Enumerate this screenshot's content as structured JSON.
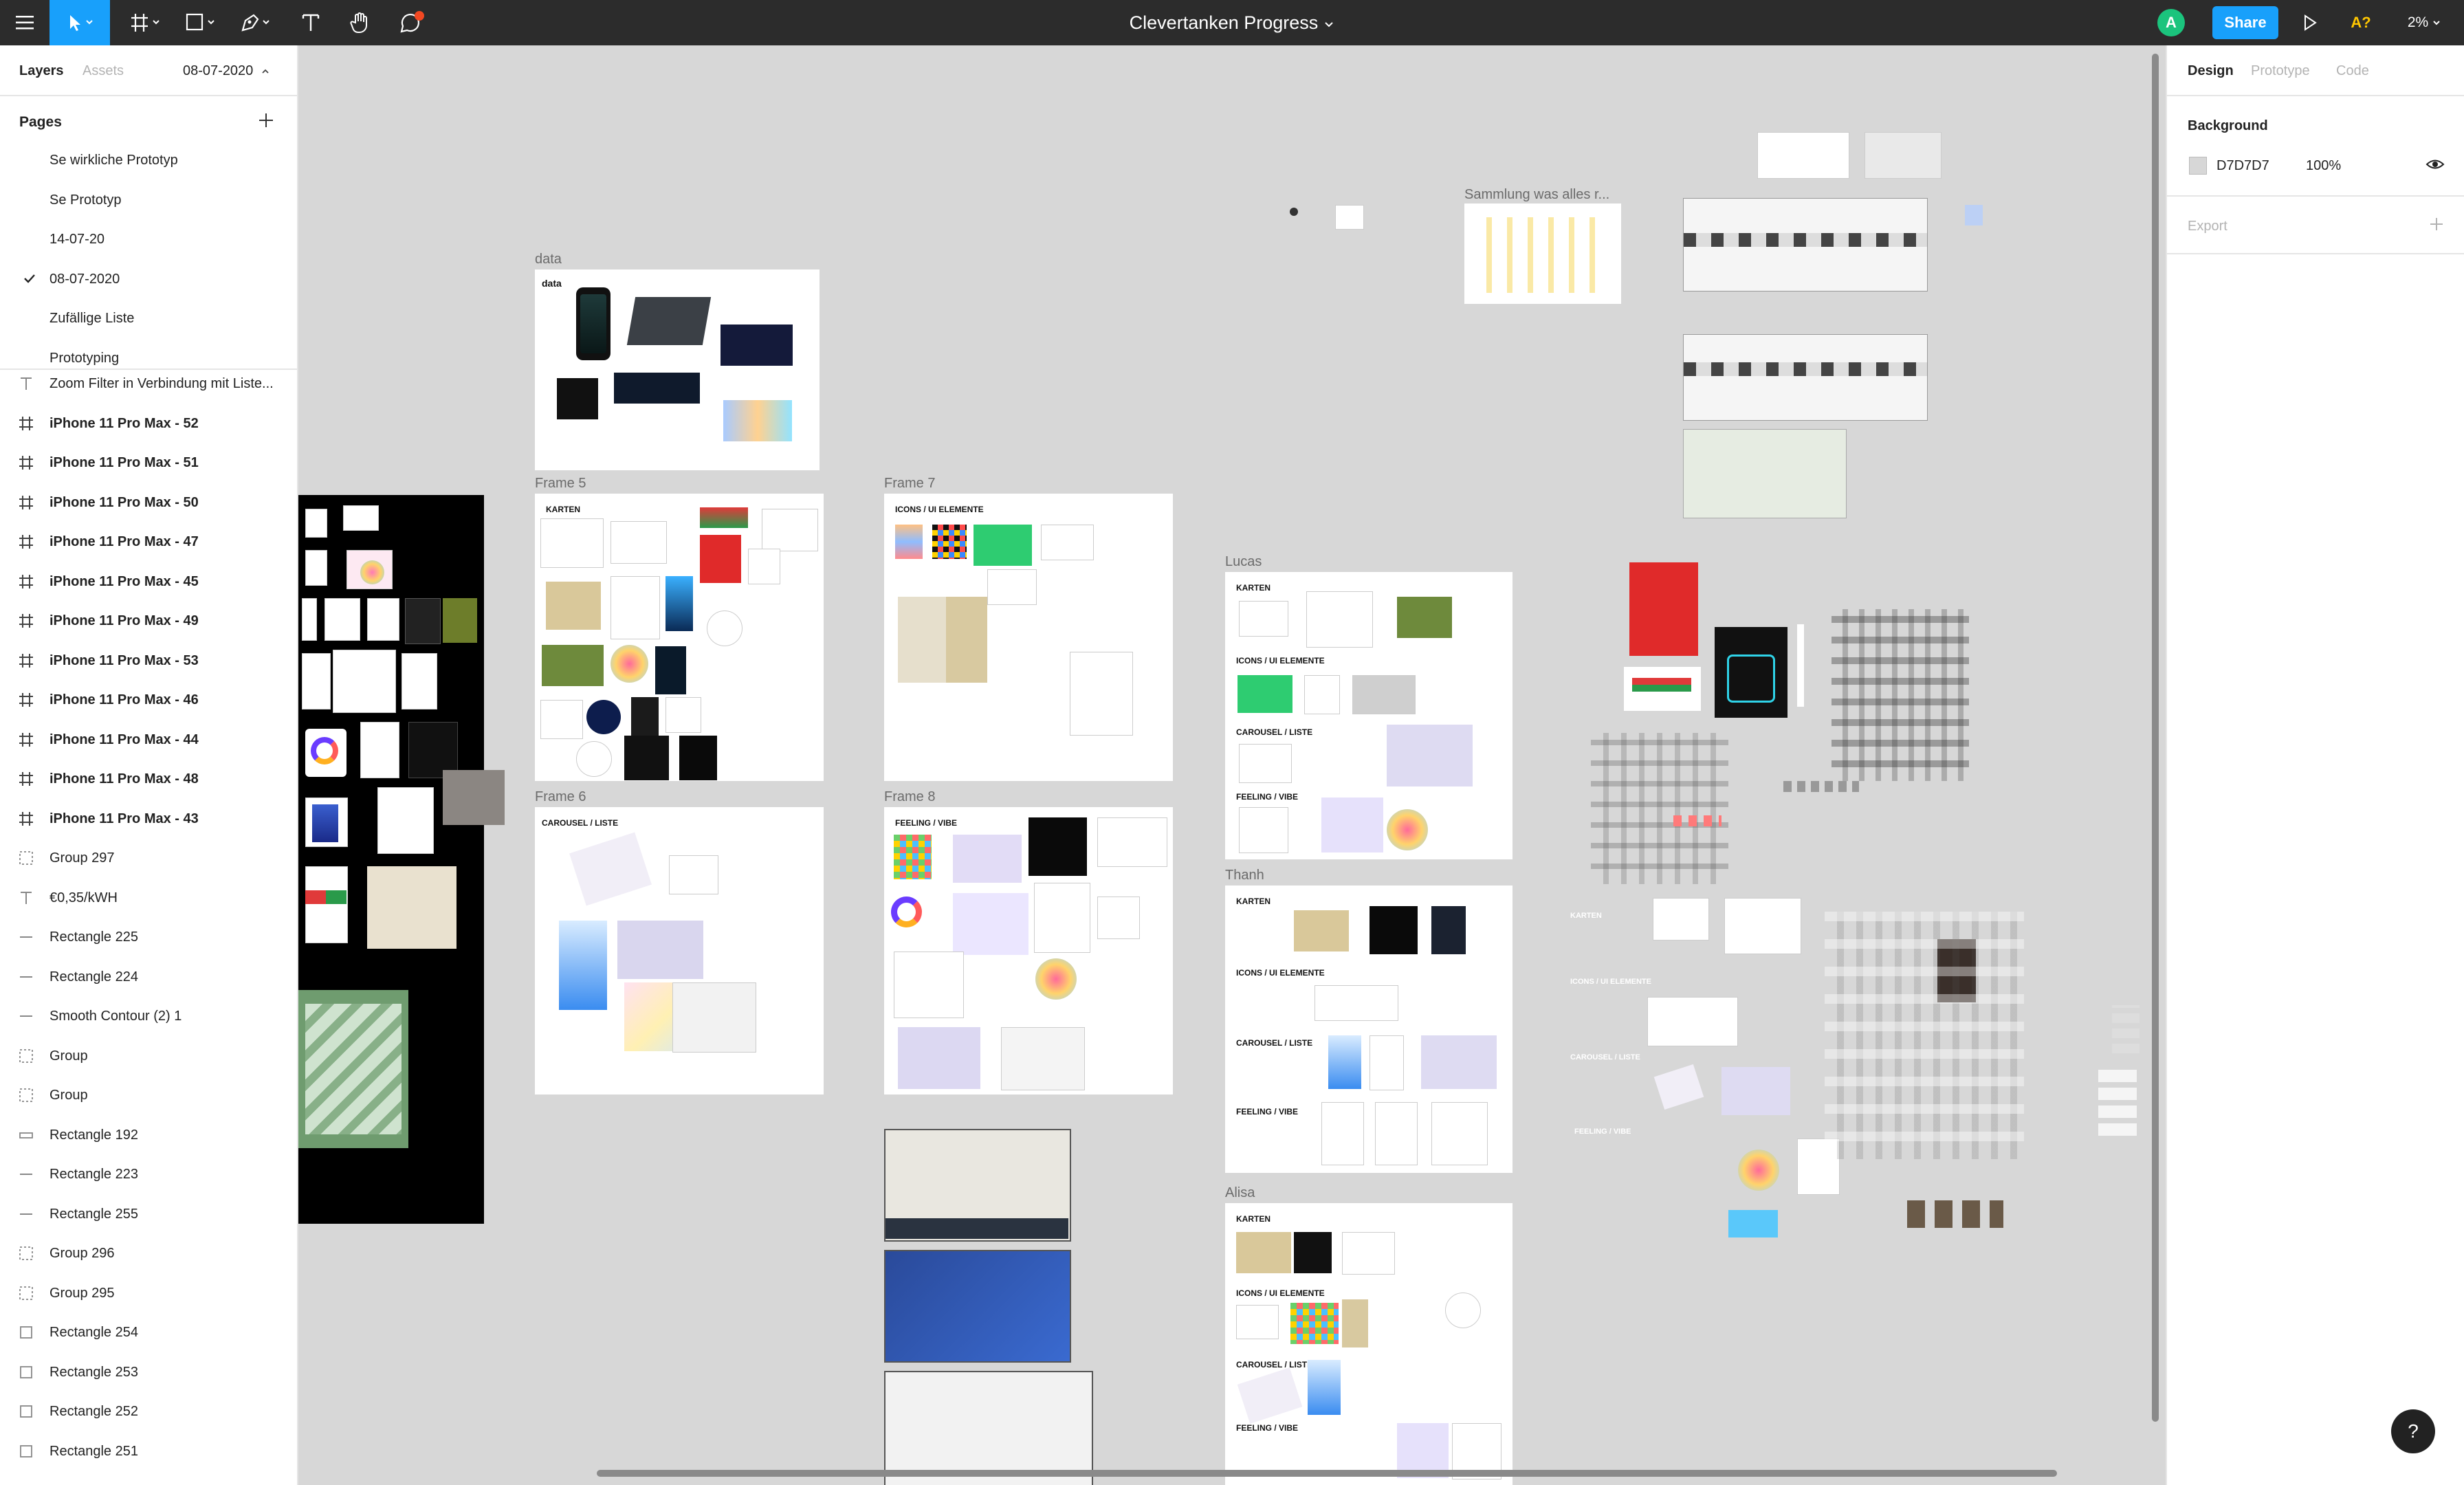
{
  "toolbar": {
    "menu_icon": "hamburger-icon",
    "tools": [
      "move-tool-icon",
      "frame-tool-icon",
      "shape-tool-icon",
      "pen-tool-icon",
      "text-tool-icon",
      "hand-tool-icon",
      "comment-tool-icon"
    ],
    "file_title": "Clevertanken Progress",
    "avatar_letter": "A",
    "share_label": "Share",
    "font_warning": "A?",
    "zoom": "2%"
  },
  "left_panel": {
    "tabs": {
      "layers": "Layers",
      "assets": "Assets"
    },
    "current_page_header": "08-07-2020",
    "pages_title": "Pages",
    "pages": [
      {
        "name": "Se wirkliche Prototyp",
        "active": false
      },
      {
        "name": "Se Prototyp",
        "active": false
      },
      {
        "name": "14-07-20",
        "active": false
      },
      {
        "name": "08-07-2020",
        "active": true
      },
      {
        "name": "Zufällige Liste",
        "active": false
      },
      {
        "name": "Prototyping",
        "active": false
      }
    ],
    "layers": [
      {
        "name": "Zoom Filter in Verbindung mit Liste...",
        "type": "text"
      },
      {
        "name": "iPhone 11 Pro Max - 52",
        "type": "frame"
      },
      {
        "name": "iPhone 11 Pro Max - 51",
        "type": "frame"
      },
      {
        "name": "iPhone 11 Pro Max - 50",
        "type": "frame"
      },
      {
        "name": "iPhone 11 Pro Max - 47",
        "type": "frame"
      },
      {
        "name": "iPhone 11 Pro Max - 45",
        "type": "frame"
      },
      {
        "name": "iPhone 11 Pro Max - 49",
        "type": "frame"
      },
      {
        "name": "iPhone 11 Pro Max - 53",
        "type": "frame"
      },
      {
        "name": "iPhone 11 Pro Max - 46",
        "type": "frame"
      },
      {
        "name": "iPhone 11 Pro Max - 44",
        "type": "frame"
      },
      {
        "name": "iPhone 11 Pro Max - 48",
        "type": "frame"
      },
      {
        "name": "iPhone 11 Pro Max - 43",
        "type": "frame"
      },
      {
        "name": "Group 297",
        "type": "group"
      },
      {
        "name": "€0,35/kWH",
        "type": "text"
      },
      {
        "name": "Rectangle 225",
        "type": "line"
      },
      {
        "name": "Rectangle 224",
        "type": "line"
      },
      {
        "name": "Smooth Contour (2) 1",
        "type": "line"
      },
      {
        "name": "Group",
        "type": "group"
      },
      {
        "name": "Group",
        "type": "group"
      },
      {
        "name": "Rectangle 192",
        "type": "rect-line"
      },
      {
        "name": "Rectangle 223",
        "type": "line"
      },
      {
        "name": "Rectangle 255",
        "type": "line"
      },
      {
        "name": "Group 296",
        "type": "group"
      },
      {
        "name": "Group 295",
        "type": "group"
      },
      {
        "name": "Rectangle 254",
        "type": "rect"
      },
      {
        "name": "Rectangle 253",
        "type": "rect"
      },
      {
        "name": "Rectangle 252",
        "type": "rect"
      },
      {
        "name": "Rectangle 251",
        "type": "rect"
      }
    ]
  },
  "right_panel": {
    "tabs": {
      "design": "Design",
      "prototype": "Prototype",
      "code": "Code"
    },
    "background_title": "Background",
    "background_hex": "D7D7D7",
    "background_opacity": "100%",
    "export_title": "Export"
  },
  "canvas": {
    "background_color": "#d7d7d7",
    "frames": {
      "data": {
        "label": "data",
        "inner_title": "data"
      },
      "frame5": {
        "label": "Frame 5",
        "sections": [
          "KARTEN"
        ]
      },
      "frame7": {
        "label": "Frame 7",
        "sections": [
          "ICONS / UI ELEMENTE"
        ]
      },
      "frame6": {
        "label": "Frame 6",
        "sections": [
          "CAROUSEL / LISTE"
        ]
      },
      "frame8": {
        "label": "Frame 8",
        "sections": [
          "FEELING / VIBE"
        ]
      },
      "lucas": {
        "label": "Lucas",
        "sections": [
          "KARTEN",
          "ICONS / UI ELEMENTE",
          "CAROUSEL / LISTE",
          "FEELING / VIBE"
        ]
      },
      "thanh": {
        "label": "Thanh",
        "sections": [
          "KARTEN",
          "ICONS / UI ELEMENTE",
          "CAROUSEL / LISTE",
          "FEELING / VIBE"
        ]
      },
      "alisa": {
        "label": "Alisa",
        "sections": [
          "KARTEN",
          "ICONS / UI ELEMENTE",
          "CAROUSEL / LISTE",
          "FEELING / VIBE"
        ]
      },
      "sammlung": {
        "label": "Sammlung was alles r..."
      }
    },
    "loose_labels": [
      "KARTEN",
      "ICONS / UI ELEMENTE",
      "CAROUSEL / LISTE",
      "FEELING / VIBE"
    ]
  },
  "help_button": "?"
}
